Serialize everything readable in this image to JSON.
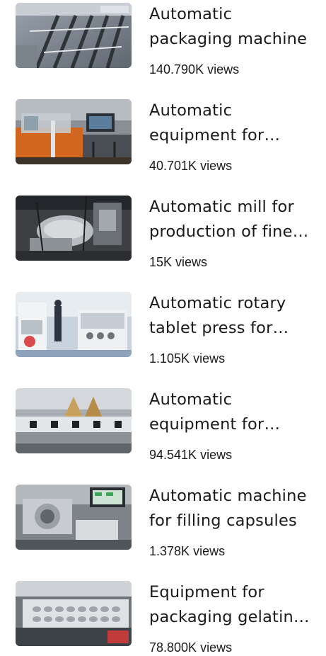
{
  "videos": [
    {
      "title": "Automatic packaging machine",
      "views": "140.790K",
      "views_suffix": "views",
      "thumbnail": "packaging-line-photo"
    },
    {
      "title": "Automatic equipment for production",
      "views": "40.701K",
      "views_suffix": "views",
      "thumbnail": "orange-equipment-photo"
    },
    {
      "title": "Automatic mill for production of fine powder",
      "views": "15K",
      "views_suffix": "views",
      "thumbnail": "mill-machine-photo"
    },
    {
      "title": "Automatic rotary tablet press for production",
      "views": "1.105K",
      "views_suffix": "views",
      "thumbnail": "tablet-press-photo"
    },
    {
      "title": "Automatic equipment for filling",
      "views": "94.541K",
      "views_suffix": "views",
      "thumbnail": "filling-line-photo"
    },
    {
      "title": "Automatic machine for filling capsules",
      "views": "1.378K",
      "views_suffix": "views",
      "thumbnail": "capsule-machine-photo"
    },
    {
      "title": "Equipment for packaging gelatin capsules",
      "views": "78.800K",
      "views_suffix": "views",
      "thumbnail": "blister-packaging-photo"
    }
  ]
}
